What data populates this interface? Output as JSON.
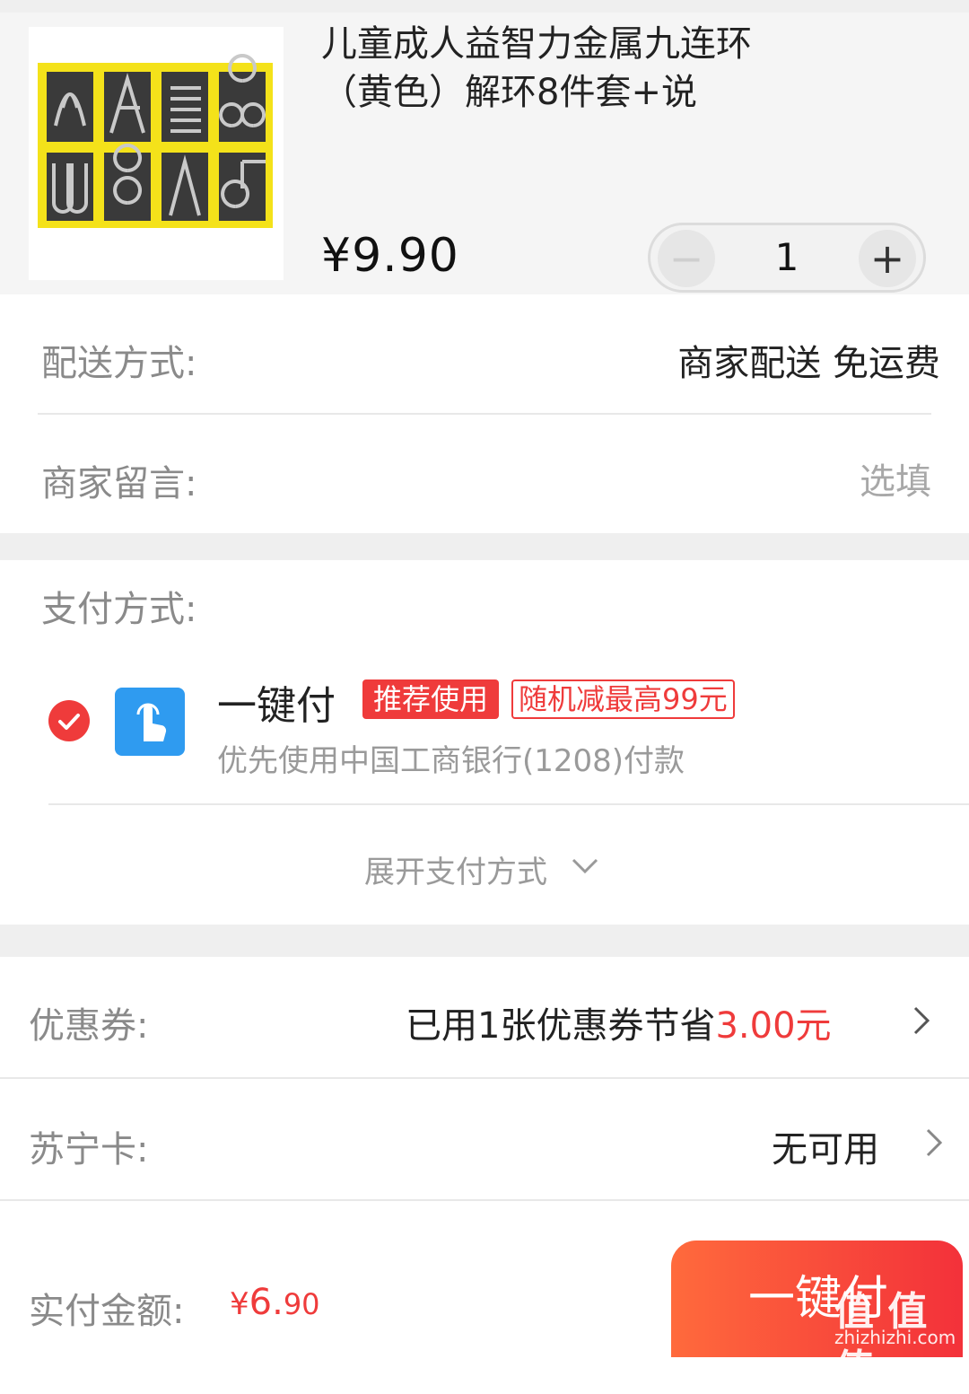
{
  "product": {
    "title": "儿童成人益智力金属九连环（黄色）解环8件套+说",
    "price": "¥9.90",
    "quantity": "1",
    "minus_symbol": "−",
    "plus_symbol": "+"
  },
  "delivery": {
    "label": "配送方式:",
    "value": "商家配送 免运费"
  },
  "message": {
    "label": "商家留言:",
    "placeholder": "选填"
  },
  "payment": {
    "label": "支付方式:",
    "method_name": "一键付",
    "tag_recommend": "推荐使用",
    "tag_discount": "随机减最高99元",
    "subtitle": "优先使用中国工商银行(1208)付款",
    "expand_label": "展开支付方式"
  },
  "coupon": {
    "label": "优惠券:",
    "value_prefix": "已用1张优惠券节省",
    "value_amount": "3.00元"
  },
  "suning_card": {
    "label": "苏宁卡:",
    "value": "无可用"
  },
  "total": {
    "label": "实付金额:",
    "currency": "¥",
    "amount_int": "6.",
    "amount_dec": "90"
  },
  "submit_button": "一键付",
  "watermark": {
    "logo": "值 值 值",
    "site": "zhizhizhi.com"
  },
  "colors": {
    "accent_red": "#ef3b3b",
    "button_gradient_start": "#ff6a3c",
    "button_gradient_end": "#f3313a",
    "pay_icon_blue": "#2f9bf0"
  }
}
